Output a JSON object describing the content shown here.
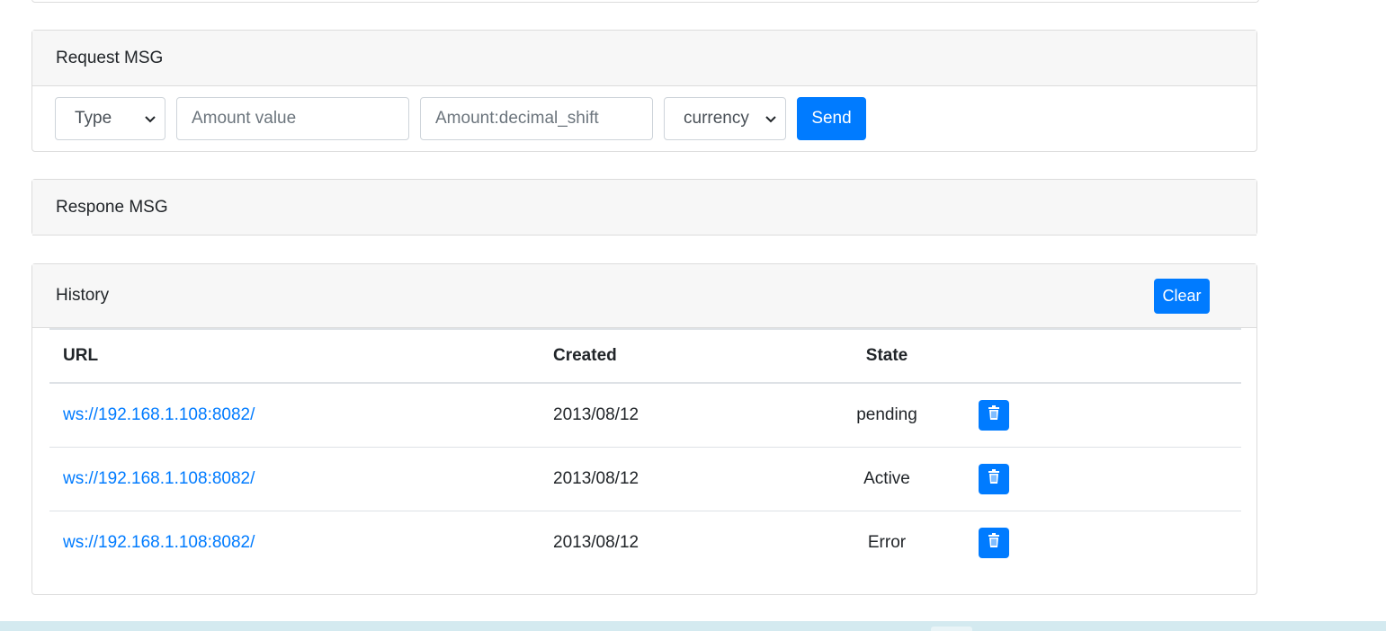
{
  "request": {
    "title": "Request MSG",
    "type_select": "Type",
    "amount_placeholder": "Amount value",
    "shift_placeholder": "Amount:decimal_shift",
    "currency_select": "currency",
    "send_label": "Send"
  },
  "response": {
    "title": "Respone MSG"
  },
  "history": {
    "title": "History",
    "clear_label": "Clear",
    "columns": [
      "URL",
      "Created",
      "State",
      ""
    ],
    "rows": [
      {
        "url": "ws://192.168.1.108:8082/",
        "created": "2013/08/12",
        "state": "pending"
      },
      {
        "url": "ws://192.168.1.108:8082/",
        "created": "2013/08/12",
        "state": "Active"
      },
      {
        "url": "ws://192.168.1.108:8082/",
        "created": "2013/08/12",
        "state": "Error"
      }
    ]
  },
  "colors": {
    "primary": "#007bff",
    "card_header_bg": "#f7f7f7",
    "border": "#dcdcdc",
    "footer": "#d4eaf0"
  },
  "icons": {
    "delete": "trash-icon",
    "select": "chevron-down-icon"
  }
}
